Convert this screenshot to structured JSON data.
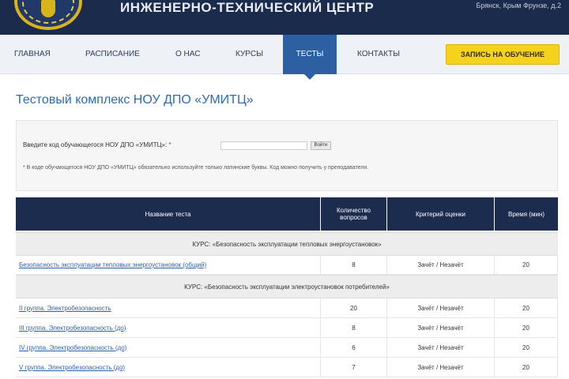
{
  "header": {
    "title": "ИНЖЕНЕРНО-ТЕХНИЧЕСКИЙ ЦЕНТР",
    "address": "Брянск, Крым Фрунзе, д.2"
  },
  "nav": {
    "items": [
      {
        "label": "Главная"
      },
      {
        "label": "Расписание"
      },
      {
        "label": "О нас"
      },
      {
        "label": "Курсы"
      },
      {
        "label": "Тесты"
      },
      {
        "label": "Контакты"
      }
    ],
    "active_index": 4,
    "signup_label": "Запись на обучение"
  },
  "page_title": "Тестовый комплекс НОУ ДПО «УМИТЦ»",
  "form": {
    "label": "Введите код обучающегося НОУ ДПО «УМИТЦ»:",
    "required_mark": "*",
    "input_value": "",
    "button_label": "Войти",
    "note": "* В коде обучающегося НОУ ДПО «УМИТЦ» обязательно используйте только латинские буквы. Код можно получить у преподавателя."
  },
  "table": {
    "headers": [
      "Название теста",
      "Количество вопросов",
      "Критерий оценки",
      "Время (мин)"
    ],
    "rows": [
      {
        "type": "course",
        "label": "КУРС: «Безопасность эксплуатации тепловых энергоустановок»"
      },
      {
        "type": "test",
        "name": "Безопасность эксплуатации тепловых энергоустановок (общий)",
        "questions": "8",
        "criterion": "Зачёт / Незачёт",
        "time": "20"
      },
      {
        "type": "course",
        "label": "КУРС: «Безопасность эксплуатации электроустановок потребителей»"
      },
      {
        "type": "test",
        "name": "II группа. Электробезопасность",
        "questions": "20",
        "criterion": "Зачёт / Незачёт",
        "time": "20"
      },
      {
        "type": "test",
        "name": "III группа. Электробезопасность (до)",
        "questions": "8",
        "criterion": "Зачёт / Незачёт",
        "time": "20"
      },
      {
        "type": "test",
        "name": "IV группа. Электробезопасность (до)",
        "questions": "6",
        "criterion": "Зачёт / Незачёт",
        "time": "20"
      },
      {
        "type": "test",
        "name": "V группа. Электробезопасность (до)",
        "questions": "7",
        "criterion": "Зачёт / Незачёт",
        "time": "20"
      }
    ]
  }
}
